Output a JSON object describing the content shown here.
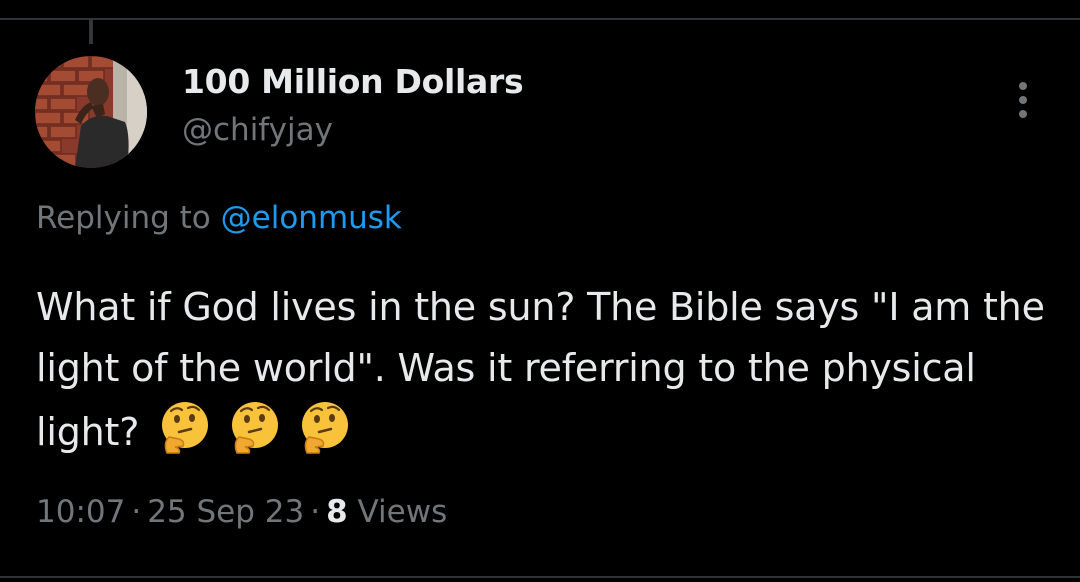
{
  "tweet": {
    "author": {
      "display_name": "100 Million Dollars",
      "handle": "@chifyjay"
    },
    "replying_prefix": "Replying to",
    "replying_to": "@elonmusk",
    "text": "What if God lives in the sun? The Bible says \"I am the light of the world\". Was it referring to the physical light?",
    "emojis": [
      "thinking-face",
      "thinking-face",
      "thinking-face"
    ],
    "time": "10:07",
    "separator": "·",
    "date": "25 Sep 23",
    "views_count": "8",
    "views_label": "Views"
  },
  "colors": {
    "background": "#000000",
    "text_primary": "#e7e9ea",
    "text_secondary": "#71767b",
    "accent": "#1d9bf0",
    "divider": "#2f3336"
  },
  "icons": {
    "more": "more-horizontal-icon",
    "emoji": "thinking-face-emoji"
  }
}
